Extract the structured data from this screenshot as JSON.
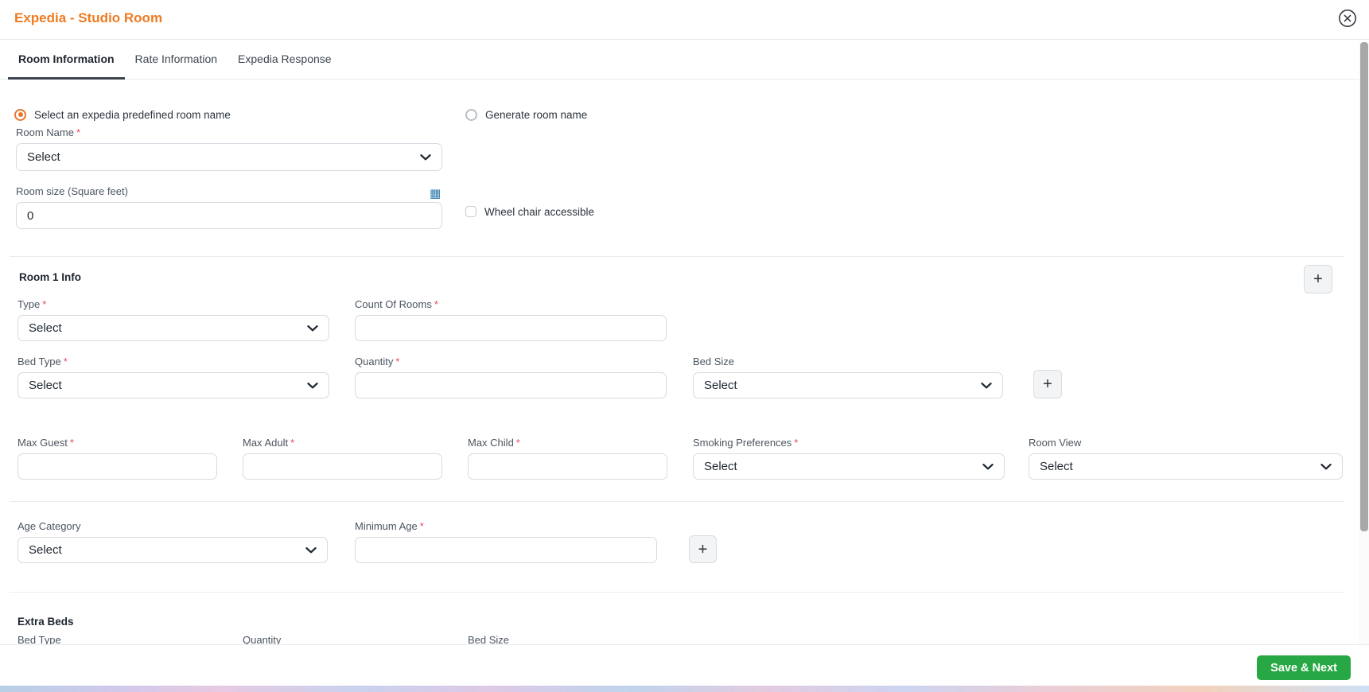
{
  "modal": {
    "title": "Expedia - Studio Room"
  },
  "tabs": {
    "active_index": 0,
    "items": [
      {
        "label": "Room Information"
      },
      {
        "label": "Rate Information"
      },
      {
        "label": "Expedia Response"
      }
    ]
  },
  "naming": {
    "predefined": {
      "label": "Select an expedia predefined room name",
      "selected": true
    },
    "generate": {
      "label": "Generate room name",
      "selected": false
    }
  },
  "general": {
    "room_name": {
      "label": "Room Name",
      "required": "*",
      "value": "Select"
    },
    "room_size": {
      "label": "Room size (Square feet)",
      "value": "0",
      "icon": "calculator-icon",
      "icon_glyph": "▦"
    },
    "wheelchair": {
      "label": "Wheel chair accessible",
      "checked": false
    }
  },
  "room1": {
    "heading": "Room 1 Info",
    "add_room_button": "+",
    "type": {
      "label": "Type",
      "required": "*",
      "value": "Select"
    },
    "count_of_rooms": {
      "label": "Count Of Rooms",
      "required": "*",
      "value": ""
    },
    "bed_type": {
      "label": "Bed Type",
      "required": "*",
      "value": "Select"
    },
    "quantity": {
      "label": "Quantity",
      "required": "*",
      "value": ""
    },
    "bed_size": {
      "label": "Bed Size",
      "value": "Select"
    },
    "add_bed_button": "+",
    "max_guest": {
      "label": "Max Guest",
      "required": "*",
      "value": ""
    },
    "max_adult": {
      "label": "Max Adult",
      "required": "*",
      "value": ""
    },
    "max_child": {
      "label": "Max Child",
      "required": "*",
      "value": ""
    },
    "smoking_preferences": {
      "label": "Smoking Preferences",
      "required": "*",
      "value": "Select"
    },
    "room_view": {
      "label": "Room View",
      "value": "Select"
    },
    "age_category": {
      "label": "Age Category",
      "value": "Select"
    },
    "minimum_age": {
      "label": "Minimum Age",
      "required": "*",
      "value": ""
    },
    "add_age_button": "+"
  },
  "extra_beds": {
    "heading": "Extra Beds",
    "columns": [
      "Bed Type",
      "Quantity",
      "Bed Size"
    ]
  },
  "footer": {
    "save_label": "Save & Next"
  },
  "colors": {
    "accent_orange": "#ee7b23",
    "required_red": "#e8485c",
    "save_green": "#28a745",
    "calculator_blue": "#2878a8",
    "tab_underline": "#3d444d"
  }
}
